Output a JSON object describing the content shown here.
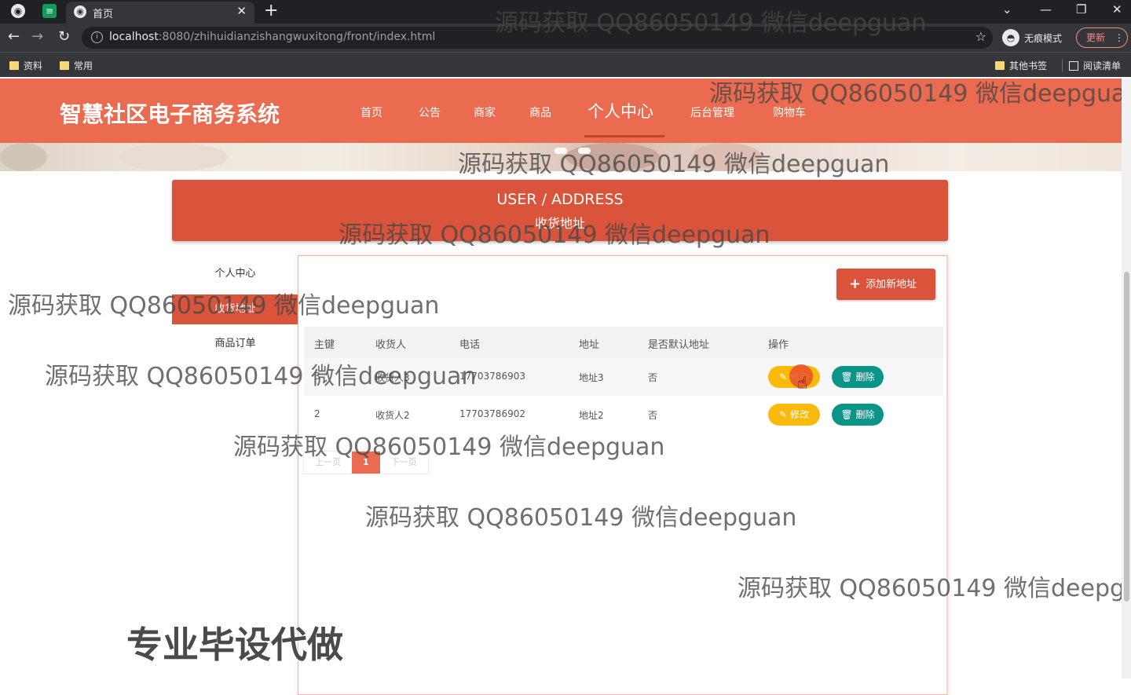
{
  "browser": {
    "tab_title": "首页",
    "url_host": "localhost",
    "url_path": ":8080/zhihuidianzishangwuxitong/front/index.html",
    "incognito_label": "无痕模式",
    "update_label": "更新",
    "bookmarks": [
      "资料",
      "常用"
    ],
    "other_bookmarks": "其他书签",
    "reading_list": "阅读清单"
  },
  "site": {
    "logo": "智慧社区电子商务系统",
    "nav": [
      "首页",
      "公告",
      "商家",
      "商品",
      "个人中心",
      "后台管理",
      "购物车"
    ],
    "active_nav": "个人中心"
  },
  "page": {
    "title_en": "USER / ADDRESS",
    "title_cn": "收货地址",
    "sidebar": [
      "个人中心",
      "收货地址",
      "商品订单"
    ],
    "add_button": "添加新地址",
    "columns": [
      "主键",
      "收货人",
      "电话",
      "地址",
      "是否默认地址",
      "操作"
    ],
    "rows": [
      {
        "id": "3",
        "receiver": "收货人3",
        "phone": "17703786903",
        "address": "地址3",
        "is_default": "否"
      },
      {
        "id": "2",
        "receiver": "收货人2",
        "phone": "17703786902",
        "address": "地址2",
        "is_default": "否"
      }
    ],
    "edit_label": "修改",
    "delete_label": "删除",
    "pagination": {
      "prev": "上一页",
      "current": "1",
      "next": "下一页"
    }
  },
  "overlay": {
    "watermark": "源码获取 QQ86050149 微信deepguan",
    "promo": "专业毕设代做"
  },
  "colors": {
    "primary": "#ea6b4f",
    "accent": "#d9543a",
    "edit": "#fbb90c",
    "delete": "#0b9488"
  }
}
